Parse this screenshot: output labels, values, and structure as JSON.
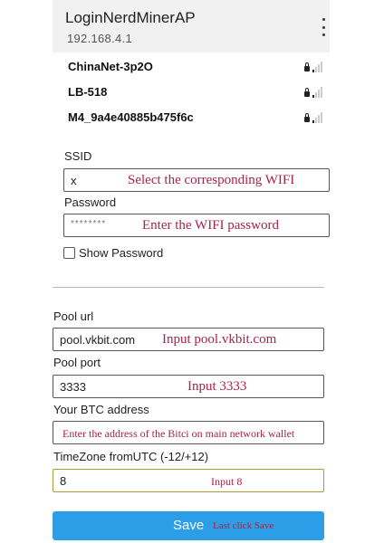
{
  "header": {
    "title": "LoginNerdMinerAP",
    "subtitle": "192.168.4.1",
    "menu_icon": "more-vertical-icon"
  },
  "wifi_networks": [
    {
      "ssid": "ChinaNet-3p2O",
      "secured": true,
      "signal_bars": 1
    },
    {
      "ssid": "LB-518",
      "secured": true,
      "signal_bars": 1
    },
    {
      "ssid": "M4_9a4e40885b475f6c",
      "secured": true,
      "signal_bars": 1
    }
  ],
  "wifi_form": {
    "ssid_label": "SSID",
    "ssid_value": "x",
    "ssid_annotation": "Select the corresponding WIFI",
    "password_label": "Password",
    "password_value": "********",
    "password_annotation": "Enter the WIFI password",
    "show_password_label": "Show Password",
    "show_password_checked": false
  },
  "pool_form": {
    "pool_url_label": "Pool url",
    "pool_url_value": "pool.vkbit.com",
    "pool_url_annotation": "Input pool.vkbit.com",
    "pool_port_label": "Pool port",
    "pool_port_value": "3333",
    "pool_port_annotation": "Input 3333",
    "btc_label": "Your BTC address",
    "btc_annotation": "Enter the address of the Bitci on main network wallet",
    "timezone_label": "TimeZone fromUTC (-12/+12)",
    "timezone_value": "8",
    "timezone_annotation": "Input 8"
  },
  "save": {
    "label": "Save",
    "annotation": "Last click Save"
  },
  "colors": {
    "accent": "#2c9ee8",
    "annotation": "#a8234a",
    "header_bg": "#f1f1f1"
  }
}
